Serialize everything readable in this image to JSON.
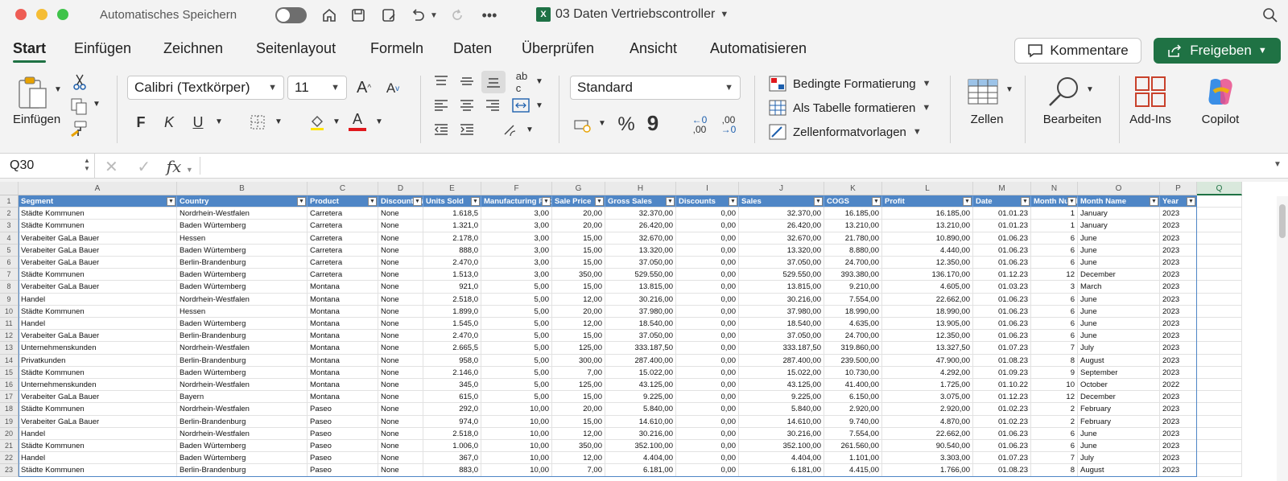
{
  "titlebar": {
    "autosave_label": "Automatisches Speichern",
    "document_title": "03 Daten Vertriebscontroller",
    "xl_badge": "X"
  },
  "tabs": [
    "Start",
    "Einfügen",
    "Zeichnen",
    "Seitenlayout",
    "Formeln",
    "Daten",
    "Überprüfen",
    "Ansicht",
    "Automatisieren"
  ],
  "actions": {
    "comment": "Kommentare",
    "share": "Freigeben"
  },
  "ribbon": {
    "paste": "Einfügen",
    "font_name": "Calibri (Textkörper)",
    "font_size": "11",
    "number_format": "Standard",
    "cond_format": "Bedingte Formatierung",
    "table_format": "Als Tabelle formatieren",
    "cell_styles": "Zellenformatvorlagen",
    "cells": "Zellen",
    "edit": "Bearbeiten",
    "addins": "Add-Ins",
    "copilot": "Copilot",
    "bold": "F",
    "italic": "K",
    "underline": "U",
    "font_color": "A",
    "inc_decimal": ",00",
    "dec_decimal": ",00",
    "percent": "%",
    "thousands": "9"
  },
  "formulabar": {
    "namebox": "Q30",
    "fx": "fx",
    "formula": ""
  },
  "columns": [
    "A",
    "B",
    "C",
    "D",
    "E",
    "F",
    "G",
    "H",
    "I",
    "J",
    "K",
    "L",
    "M",
    "N",
    "O",
    "P",
    "Q"
  ],
  "selected_column": "Q",
  "headers": [
    "Segment",
    "Country",
    "Product",
    "Discount Band",
    "Units Sold",
    "Manufacturing Price",
    "Sale Price",
    "Gross Sales",
    "Discounts",
    "Sales",
    "COGS",
    "Profit",
    "Date",
    "Month Number",
    "Month Name",
    "Year"
  ],
  "rows": [
    [
      "Städte Kommunen",
      "Nordrhein-Westfalen",
      "Carretera",
      "None",
      "1.618,5",
      "3,00",
      "20,00",
      "32.370,00",
      "0,00",
      "32.370,00",
      "16.185,00",
      "16.185,00",
      "01.01.23",
      "1",
      "January",
      "2023"
    ],
    [
      "Städte Kommunen",
      "Baden Würtemberg",
      "Carretera",
      "None",
      "1.321,0",
      "3,00",
      "20,00",
      "26.420,00",
      "0,00",
      "26.420,00",
      "13.210,00",
      "13.210,00",
      "01.01.23",
      "1",
      "January",
      "2023"
    ],
    [
      "Verabeiter GaLa Bauer",
      "Hessen",
      "Carretera",
      "None",
      "2.178,0",
      "3,00",
      "15,00",
      "32.670,00",
      "0,00",
      "32.670,00",
      "21.780,00",
      "10.890,00",
      "01.06.23",
      "6",
      "June",
      "2023"
    ],
    [
      "Verabeiter GaLa Bauer",
      "Baden Würtemberg",
      "Carretera",
      "None",
      "888,0",
      "3,00",
      "15,00",
      "13.320,00",
      "0,00",
      "13.320,00",
      "8.880,00",
      "4.440,00",
      "01.06.23",
      "6",
      "June",
      "2023"
    ],
    [
      "Verabeiter GaLa Bauer",
      "Berlin-Brandenburg",
      "Carretera",
      "None",
      "2.470,0",
      "3,00",
      "15,00",
      "37.050,00",
      "0,00",
      "37.050,00",
      "24.700,00",
      "12.350,00",
      "01.06.23",
      "6",
      "June",
      "2023"
    ],
    [
      "Städte Kommunen",
      "Baden Würtemberg",
      "Carretera",
      "None",
      "1.513,0",
      "3,00",
      "350,00",
      "529.550,00",
      "0,00",
      "529.550,00",
      "393.380,00",
      "136.170,00",
      "01.12.23",
      "12",
      "December",
      "2023"
    ],
    [
      "Verabeiter GaLa Bauer",
      "Baden Würtemberg",
      "Montana",
      "None",
      "921,0",
      "5,00",
      "15,00",
      "13.815,00",
      "0,00",
      "13.815,00",
      "9.210,00",
      "4.605,00",
      "01.03.23",
      "3",
      "March",
      "2023"
    ],
    [
      "Handel",
      "Nordrhein-Westfalen",
      "Montana",
      "None",
      "2.518,0",
      "5,00",
      "12,00",
      "30.216,00",
      "0,00",
      "30.216,00",
      "7.554,00",
      "22.662,00",
      "01.06.23",
      "6",
      "June",
      "2023"
    ],
    [
      "Städte Kommunen",
      "Hessen",
      "Montana",
      "None",
      "1.899,0",
      "5,00",
      "20,00",
      "37.980,00",
      "0,00",
      "37.980,00",
      "18.990,00",
      "18.990,00",
      "01.06.23",
      "6",
      "June",
      "2023"
    ],
    [
      "Handel",
      "Baden Würtemberg",
      "Montana",
      "None",
      "1.545,0",
      "5,00",
      "12,00",
      "18.540,00",
      "0,00",
      "18.540,00",
      "4.635,00",
      "13.905,00",
      "01.06.23",
      "6",
      "June",
      "2023"
    ],
    [
      "Verabeiter GaLa Bauer",
      "Berlin-Brandenburg",
      "Montana",
      "None",
      "2.470,0",
      "5,00",
      "15,00",
      "37.050,00",
      "0,00",
      "37.050,00",
      "24.700,00",
      "12.350,00",
      "01.06.23",
      "6",
      "June",
      "2023"
    ],
    [
      "Unternehmenskunden",
      "Nordrhein-Westfalen",
      "Montana",
      "None",
      "2.665,5",
      "5,00",
      "125,00",
      "333.187,50",
      "0,00",
      "333.187,50",
      "319.860,00",
      "13.327,50",
      "01.07.23",
      "7",
      "July",
      "2023"
    ],
    [
      "Privatkunden",
      "Berlin-Brandenburg",
      "Montana",
      "None",
      "958,0",
      "5,00",
      "300,00",
      "287.400,00",
      "0,00",
      "287.400,00",
      "239.500,00",
      "47.900,00",
      "01.08.23",
      "8",
      "August",
      "2023"
    ],
    [
      "Städte Kommunen",
      "Baden Würtemberg",
      "Montana",
      "None",
      "2.146,0",
      "5,00",
      "7,00",
      "15.022,00",
      "0,00",
      "15.022,00",
      "10.730,00",
      "4.292,00",
      "01.09.23",
      "9",
      "September",
      "2023"
    ],
    [
      "Unternehmenskunden",
      "Nordrhein-Westfalen",
      "Montana",
      "None",
      "345,0",
      "5,00",
      "125,00",
      "43.125,00",
      "0,00",
      "43.125,00",
      "41.400,00",
      "1.725,00",
      "01.10.22",
      "10",
      "October",
      "2022"
    ],
    [
      "Verabeiter GaLa Bauer",
      "Bayern",
      "Montana",
      "None",
      "615,0",
      "5,00",
      "15,00",
      "9.225,00",
      "0,00",
      "9.225,00",
      "6.150,00",
      "3.075,00",
      "01.12.23",
      "12",
      "December",
      "2023"
    ],
    [
      "Städte Kommunen",
      "Nordrhein-Westfalen",
      "Paseo",
      "None",
      "292,0",
      "10,00",
      "20,00",
      "5.840,00",
      "0,00",
      "5.840,00",
      "2.920,00",
      "2.920,00",
      "01.02.23",
      "2",
      "February",
      "2023"
    ],
    [
      "Verabeiter GaLa Bauer",
      "Berlin-Brandenburg",
      "Paseo",
      "None",
      "974,0",
      "10,00",
      "15,00",
      "14.610,00",
      "0,00",
      "14.610,00",
      "9.740,00",
      "4.870,00",
      "01.02.23",
      "2",
      "February",
      "2023"
    ],
    [
      "Handel",
      "Nordrhein-Westfalen",
      "Paseo",
      "None",
      "2.518,0",
      "10,00",
      "12,00",
      "30.216,00",
      "0,00",
      "30.216,00",
      "7.554,00",
      "22.662,00",
      "01.06.23",
      "6",
      "June",
      "2023"
    ],
    [
      "Städte Kommunen",
      "Baden Würtemberg",
      "Paseo",
      "None",
      "1.006,0",
      "10,00",
      "350,00",
      "352.100,00",
      "0,00",
      "352.100,00",
      "261.560,00",
      "90.540,00",
      "01.06.23",
      "6",
      "June",
      "2023"
    ],
    [
      "Handel",
      "Baden Würtemberg",
      "Paseo",
      "None",
      "367,0",
      "10,00",
      "12,00",
      "4.404,00",
      "0,00",
      "4.404,00",
      "1.101,00",
      "3.303,00",
      "01.07.23",
      "7",
      "July",
      "2023"
    ],
    [
      "Städte Kommunen",
      "Berlin-Brandenburg",
      "Paseo",
      "None",
      "883,0",
      "10,00",
      "7,00",
      "6.181,00",
      "0,00",
      "6.181,00",
      "4.415,00",
      "1.766,00",
      "01.08.23",
      "8",
      "August",
      "2023"
    ]
  ]
}
